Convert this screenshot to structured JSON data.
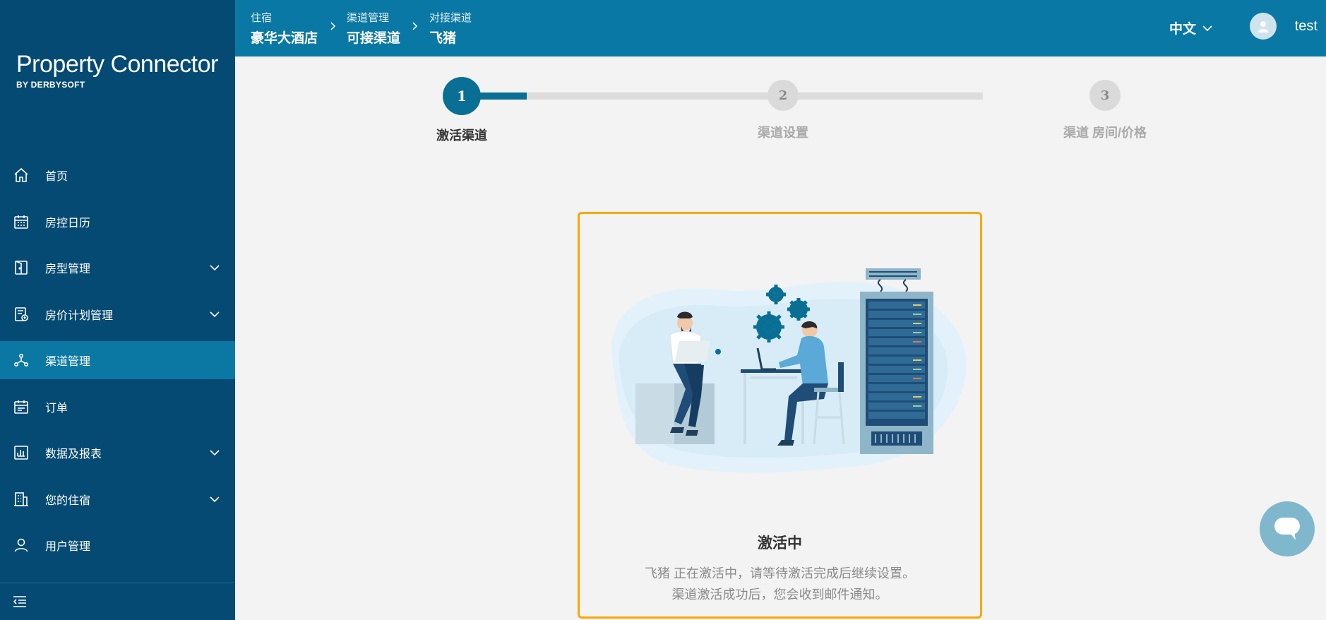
{
  "brand": {
    "title": "Property Connector",
    "subtitle": "BY DERBYSOFT"
  },
  "sidebar": {
    "items": [
      {
        "label": "首页",
        "icon": "home-icon",
        "expandable": false,
        "active": false
      },
      {
        "label": "房控日历",
        "icon": "calendar-icon",
        "expandable": false,
        "active": false
      },
      {
        "label": "房型管理",
        "icon": "door-icon",
        "expandable": true,
        "active": false
      },
      {
        "label": "房价计划管理",
        "icon": "rate-plan-icon",
        "expandable": true,
        "active": false
      },
      {
        "label": "渠道管理",
        "icon": "channel-icon",
        "expandable": false,
        "active": true
      },
      {
        "label": "订单",
        "icon": "order-icon",
        "expandable": false,
        "active": false
      },
      {
        "label": "数据及报表",
        "icon": "report-icon",
        "expandable": true,
        "active": false
      },
      {
        "label": "您的住宿",
        "icon": "building-icon",
        "expandable": true,
        "active": false
      },
      {
        "label": "用户管理",
        "icon": "user-icon",
        "expandable": false,
        "active": false
      }
    ],
    "collapse_icon": "collapse-menu-icon"
  },
  "header": {
    "breadcrumb": [
      {
        "small": "住宿",
        "big": "豪华大酒店"
      },
      {
        "small": "渠道管理",
        "big": "可接渠道"
      },
      {
        "small": "对接渠道",
        "big": "飞猪"
      }
    ],
    "language": "中文",
    "username": "test"
  },
  "stepper": {
    "progress": 0.125,
    "steps": [
      {
        "number": "1",
        "label": "激活渠道",
        "active": true
      },
      {
        "number": "2",
        "label": "渠道设置",
        "active": false
      },
      {
        "number": "3",
        "label": "渠道 房间/价格",
        "active": false
      }
    ]
  },
  "card": {
    "title": "激活中",
    "message_line1": "飞猪 正在激活中，请等待激活完成后继续设置。",
    "message_line2": "渠道激活成功后，您会收到邮件通知。"
  },
  "colors": {
    "sidebar_bg": "#044a73",
    "header_bg": "#0978a4",
    "active_item": "#0a78a3",
    "accent": "#0a6f95",
    "card_border": "#f6a800"
  }
}
